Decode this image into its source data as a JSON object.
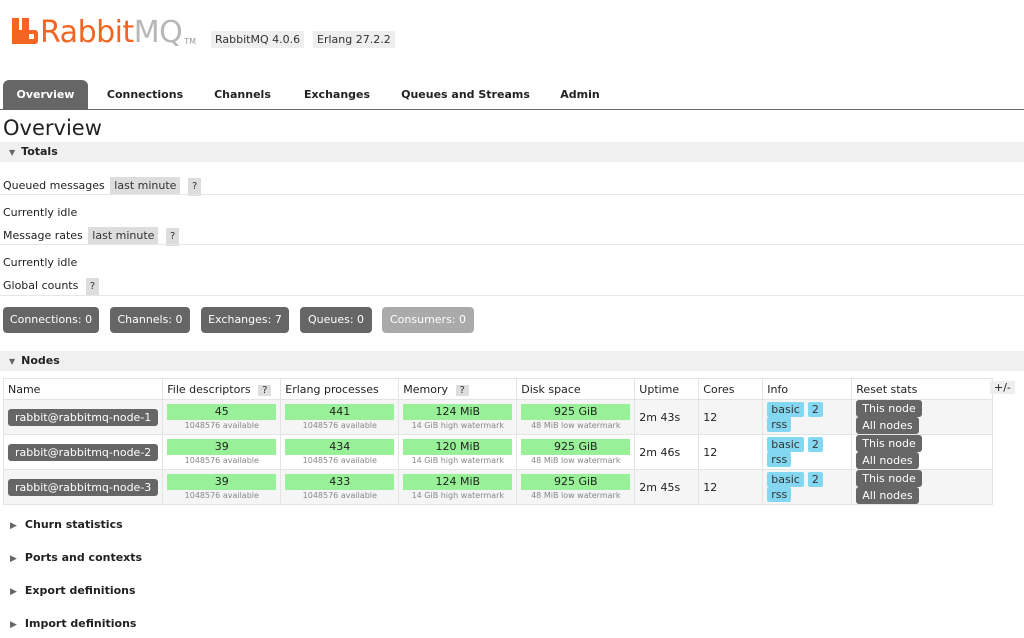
{
  "brand": {
    "rabbit": "Rabbit",
    "mq": "MQ",
    "tm": "TM"
  },
  "versions": {
    "rabbitmq": "RabbitMQ 4.0.6",
    "erlang": "Erlang 27.2.2"
  },
  "tabs": [
    "Overview",
    "Connections",
    "Channels",
    "Exchanges",
    "Queues and Streams",
    "Admin"
  ],
  "page_title": "Overview",
  "totals": {
    "heading": "Totals",
    "queued_label": "Queued messages",
    "queued_range": "last minute",
    "help": "?",
    "queued_status": "Currently idle",
    "rates_label": "Message rates",
    "rates_range": "last minute",
    "rates_status": "Currently idle",
    "global_label": "Global counts"
  },
  "counts": {
    "connections": "Connections: 0",
    "channels": "Channels: 0",
    "exchanges": "Exchanges: 7",
    "queues": "Queues: 0",
    "consumers": "Consumers: 0"
  },
  "nodes": {
    "heading": "Nodes",
    "plus_minus": "+/-",
    "columns": [
      "Name",
      "File descriptors",
      "Erlang processes",
      "Memory",
      "Disk space",
      "Uptime",
      "Cores",
      "Info",
      "Reset stats"
    ],
    "rows": [
      {
        "name": "rabbit@rabbitmq-node-1",
        "fd": "45",
        "fd_sub": "1048576 available",
        "proc": "441",
        "proc_sub": "1048576 available",
        "mem": "124 MiB",
        "mem_sub": "14 GiB high watermark",
        "disk": "925 GiB",
        "disk_sub": "48 MiB low watermark",
        "uptime": "2m 43s",
        "cores": "12",
        "info": [
          "basic",
          "2",
          "rss"
        ],
        "this_node": "This node",
        "all_nodes": "All nodes"
      },
      {
        "name": "rabbit@rabbitmq-node-2",
        "fd": "39",
        "fd_sub": "1048576 available",
        "proc": "434",
        "proc_sub": "1048576 available",
        "mem": "120 MiB",
        "mem_sub": "14 GiB high watermark",
        "disk": "925 GiB",
        "disk_sub": "48 MiB low watermark",
        "uptime": "2m 46s",
        "cores": "12",
        "info": [
          "basic",
          "2",
          "rss"
        ],
        "this_node": "This node",
        "all_nodes": "All nodes"
      },
      {
        "name": "rabbit@rabbitmq-node-3",
        "fd": "39",
        "fd_sub": "1048576 available",
        "proc": "433",
        "proc_sub": "1048576 available",
        "mem": "124 MiB",
        "mem_sub": "14 GiB high watermark",
        "disk": "925 GiB",
        "disk_sub": "48 MiB low watermark",
        "uptime": "2m 45s",
        "cores": "12",
        "info": [
          "basic",
          "2",
          "rss"
        ],
        "this_node": "This node",
        "all_nodes": "All nodes"
      }
    ]
  },
  "collapsed_sections": [
    "Churn statistics",
    "Ports and contexts",
    "Export definitions",
    "Import definitions"
  ],
  "colors": {
    "brand_orange": "#f26522",
    "tab_active": "#666666",
    "ok_green": "#98f098",
    "info_blue": "#84d7f0"
  }
}
